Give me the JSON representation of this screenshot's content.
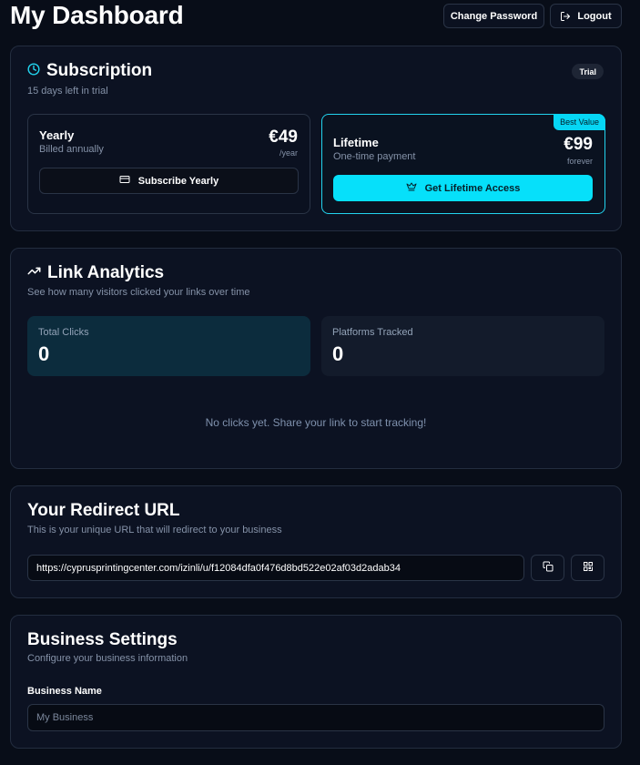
{
  "header": {
    "title": "My Dashboard",
    "change_password_label": "Change Password",
    "logout_label": "Logout"
  },
  "subscription": {
    "title": "Subscription",
    "subtitle": "15 days left in trial",
    "badge": "Trial",
    "plans": [
      {
        "name": "Yearly",
        "description": "Billed annually",
        "price": "€49",
        "period": "/year",
        "button_label": "Subscribe Yearly"
      },
      {
        "name": "Lifetime",
        "description": "One-time payment",
        "price": "€99",
        "period": "forever",
        "badge": "Best Value",
        "button_label": "Get Lifetime Access"
      }
    ]
  },
  "analytics": {
    "title": "Link Analytics",
    "subtitle": "See how many visitors clicked your links over time",
    "stats": [
      {
        "label": "Total Clicks",
        "value": "0"
      },
      {
        "label": "Platforms Tracked",
        "value": "0"
      }
    ],
    "empty_message": "No clicks yet. Share your link to start tracking!"
  },
  "redirect": {
    "title": "Your Redirect URL",
    "subtitle": "This is your unique URL that will redirect to your business",
    "url": "https://cyprusprintingcenter.com/izinli/u/f12084dfa0f476d8bd522e02af03d2adab34"
  },
  "business": {
    "title": "Business Settings",
    "subtitle": "Configure your business information",
    "name_label": "Business Name",
    "name_placeholder": "My Business"
  },
  "icons": {
    "subscription": "clock-icon",
    "analytics": "trending-up-icon",
    "logout": "logout-icon",
    "subscribe": "credit-card-icon",
    "lifetime": "crown-icon",
    "copy": "copy-icon",
    "qr": "qr-code-icon"
  },
  "colors": {
    "accent": "#06e0fa",
    "background": "#080d18",
    "card": "#0c1222"
  }
}
